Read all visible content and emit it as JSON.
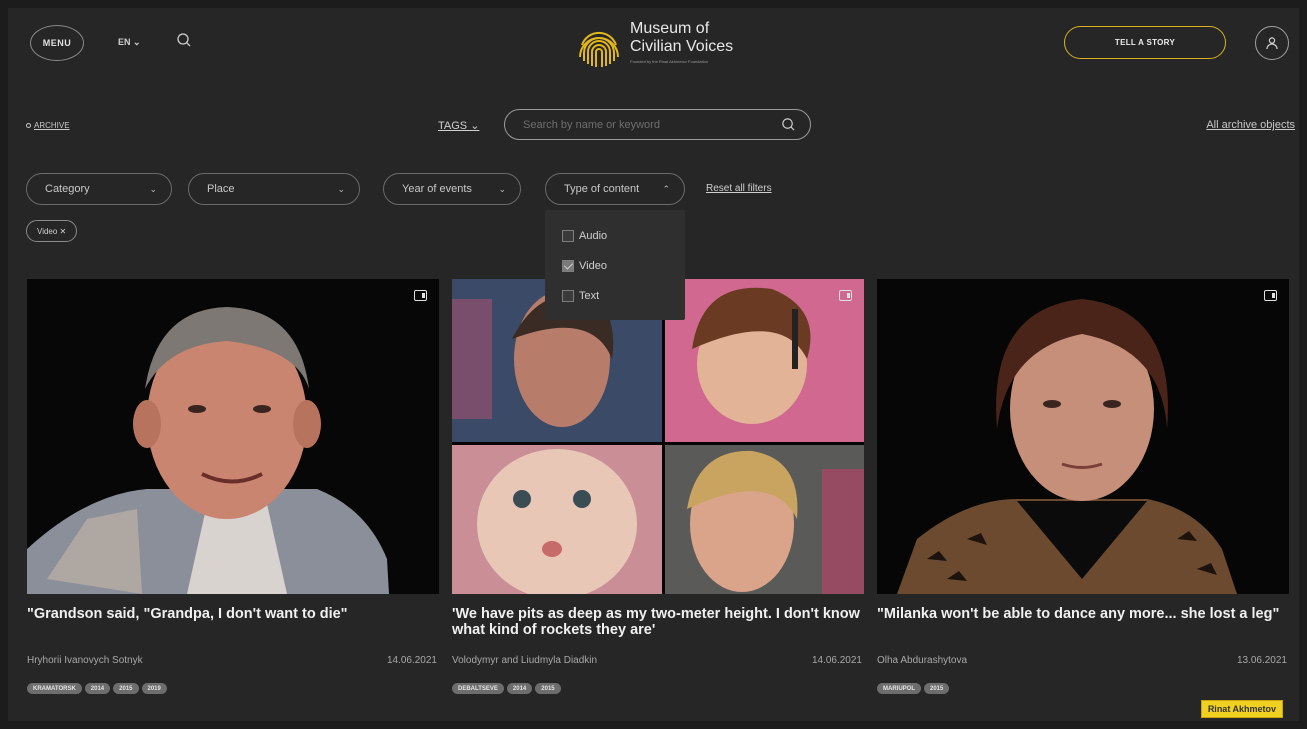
{
  "header": {
    "menu_label": "MENU",
    "lang_label": "EN ⌄",
    "logo_line1": "Museum of",
    "logo_line2": "Civilian Voices",
    "logo_sub": "Founded by the Rinat Akhmetov Foundation",
    "tell_story_label": "TELL A STORY"
  },
  "archive_bar": {
    "archive_label": "ARCHIVE",
    "tags_label": "TAGS ⌄",
    "search_placeholder": "Search by name or keyword",
    "all_archive_label": "All archive objects"
  },
  "filters": {
    "category": "Category",
    "place": "Place",
    "year": "Year of events",
    "type": "Type of content",
    "reset": "Reset all filters"
  },
  "active_chip": "Video ✕",
  "dropdown": {
    "options": [
      {
        "label": "Audio",
        "checked": false
      },
      {
        "label": "Video",
        "checked": true
      },
      {
        "label": "Text",
        "checked": false
      }
    ]
  },
  "cards": [
    {
      "title": "\"Grandson said, \"Grandpa, I don't want to die\"",
      "author": "Hryhorii Ivanovych Sotnyk",
      "date": "14.06.2021",
      "tags": [
        "KRAMATORSK",
        "2014",
        "2015",
        "2019"
      ]
    },
    {
      "title": "'We have pits as deep as my two-meter height. I don't know what kind of rockets they are'",
      "author": "Volodymyr and Liudmyla Diadkin",
      "date": "14.06.2021",
      "tags": [
        "DEBALTSEVE",
        "2014",
        "2015"
      ]
    },
    {
      "title": "\"Milanka won't be able to dance any more... she lost a leg\"",
      "author": "Olha Abdurashytova",
      "date": "13.06.2021",
      "tags": [
        "MARIUPOL",
        "2015"
      ]
    }
  ],
  "corner_badge": "Rinat Akhmetov",
  "colors": {
    "background": "#262626",
    "accent": "#d8b020"
  }
}
